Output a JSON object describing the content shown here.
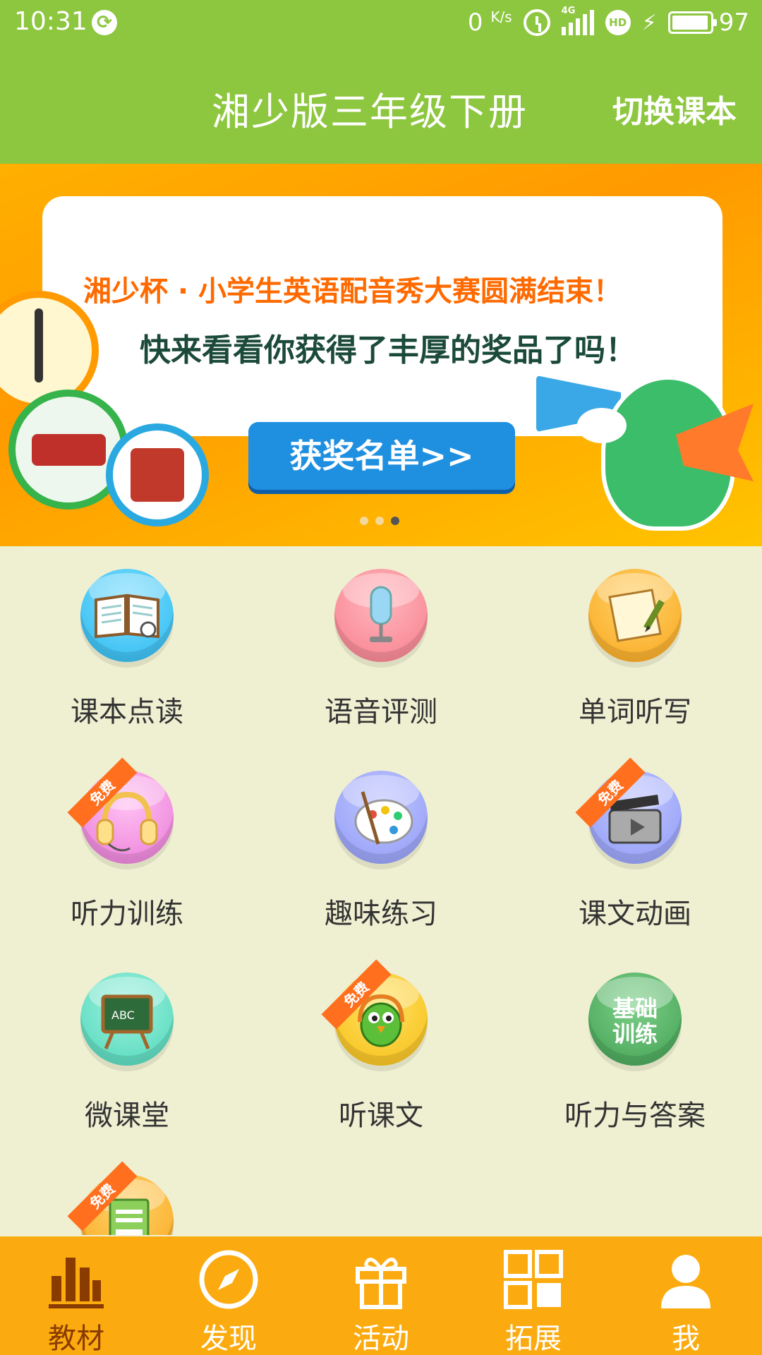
{
  "status_bar": {
    "time": "10:31",
    "net_speed": "0",
    "net_unit": "K/s",
    "signal_type": "4G",
    "hd_badge": "HD",
    "battery_level": "97",
    "battery_fraction": 0.97
  },
  "header": {
    "title": "湘少版三年级下册",
    "switch_label": "切换课本"
  },
  "banner": {
    "line1": "湘少杯 · 小学生英语配音秀大赛圆满结束！",
    "line2": "快来看看你获得了丰厚的奖品了吗！",
    "button_label": "获奖名单>>",
    "pages": 3,
    "active_page": 3
  },
  "features": [
    {
      "label": "课本点读",
      "icon": "book-reading-icon",
      "free": false,
      "free_label": ""
    },
    {
      "label": "语音评测",
      "icon": "microphone-icon",
      "free": false,
      "free_label": ""
    },
    {
      "label": "单词听写",
      "icon": "notepad-pencil-icon",
      "free": false,
      "free_label": ""
    },
    {
      "label": "听力训练",
      "icon": "headphones-icon",
      "free": true,
      "free_label": "免费"
    },
    {
      "label": "趣味练习",
      "icon": "paint-palette-icon",
      "free": false,
      "free_label": ""
    },
    {
      "label": "课文动画",
      "icon": "clapperboard-icon",
      "free": true,
      "free_label": "免费"
    },
    {
      "label": "微课堂",
      "icon": "chalkboard-icon",
      "free": false,
      "free_label": ""
    },
    {
      "label": "听课文",
      "icon": "bird-headphones-icon",
      "free": true,
      "free_label": "免费"
    },
    {
      "label": "听力与答案",
      "icon": "basic-training-icon",
      "free": false,
      "free_label": "",
      "icon_text": "基础训练"
    },
    {
      "label": "",
      "icon": "document-icon",
      "free": true,
      "free_label": "免费"
    }
  ],
  "nav": [
    {
      "label": "教材",
      "icon": "bar-chart-icon",
      "active": true
    },
    {
      "label": "发现",
      "icon": "compass-icon",
      "active": false
    },
    {
      "label": "活动",
      "icon": "gift-icon",
      "active": false
    },
    {
      "label": "拓展",
      "icon": "grid-icon",
      "active": false
    },
    {
      "label": "我",
      "icon": "user-icon",
      "active": false
    }
  ],
  "colors": {
    "header_green": "#8dc63f",
    "page_bg": "#efefd2",
    "nav_orange": "#fbab10",
    "nav_active": "#8a3b00",
    "free_tag": "#ff6f1e"
  }
}
